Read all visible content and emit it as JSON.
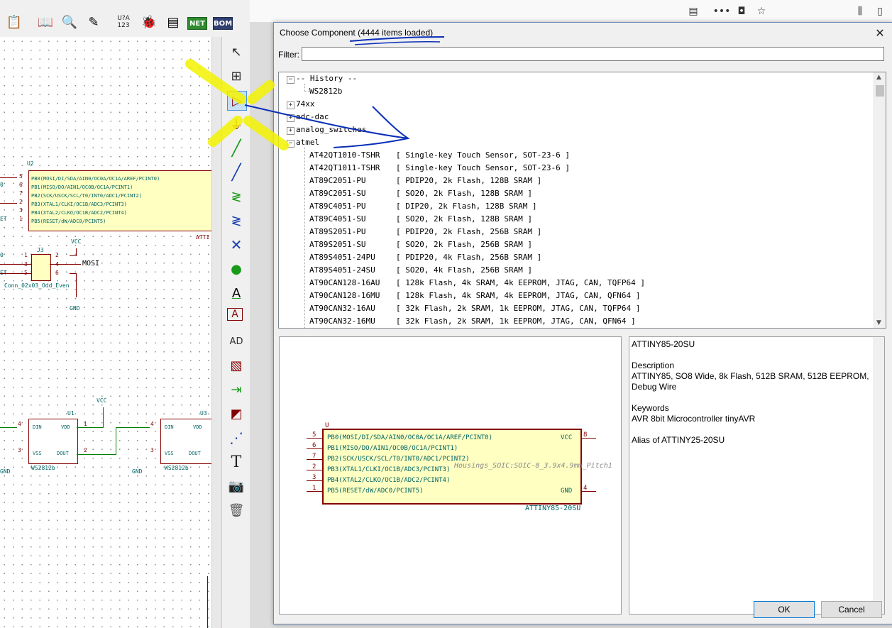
{
  "toolbar": {
    "icons": [
      "paste-icon",
      "library-editor-icon",
      "library-browser-icon",
      "annotate-icon",
      "symbol-unit-icon",
      "erc-icon",
      "footprint-assign-icon",
      "netlist-icon",
      "bom-icon"
    ],
    "symbol_unit_label": "U?A",
    "symbol_unit_sub": "123",
    "net_label": "NET",
    "bom_label": "BOM"
  },
  "schematic": {
    "u2": {
      "ref": "U2",
      "value": "ATTI",
      "pins": [
        "PB0(MOSI/DI/SDA/AIN0/OC0A/OC1A/AREF/PCINT0)",
        "PB1(MISO/DO/AIN1/OC0B/OC1A/PCINT1)",
        "PB2(SCK/USCK/SCL/T0/INT0/ADC1/PCINT2)",
        "PB3(XTAL1/CLKI/OC1B/ADC3/PCINT3)",
        "PB4(XTAL2/CLKO/OC1B/ADC2/PCINT4)",
        "PB5(RESET/dW/ADC0/PCINT5)"
      ],
      "pin_numbers": [
        "5",
        "6",
        "7",
        "2",
        "3",
        "1"
      ],
      "left_labels": [
        "",
        "0",
        "",
        "",
        "",
        "ET"
      ]
    },
    "j3": {
      "ref": "J3",
      "value": "Conn_02x03_Odd_Even",
      "left_nums": [
        "1",
        "3",
        "5"
      ],
      "right_nums": [
        "2",
        "4",
        "6"
      ],
      "left_labels": [
        "0",
        "",
        "ET"
      ],
      "mosi_label": "MOSI",
      "vcc_label": "VCC",
      "gnd_label": "GND"
    },
    "u1": {
      "ref": "U1",
      "value": "WS2812b",
      "pins": [
        "DIN",
        "VDD",
        "VSS",
        "DOUT"
      ],
      "pin_nums": [
        "4",
        "1",
        "3",
        "2"
      ],
      "vcc_label": "VCC",
      "gnd_label": "GND"
    },
    "u3": {
      "ref": "U3",
      "value": "WS2812b",
      "pins": [
        "DIN",
        "VDD",
        "VSS",
        "DOUT"
      ],
      "pin_nums": [
        "4",
        "3"
      ],
      "gnd_label": "GND"
    },
    "left_gnd": "GND"
  },
  "right_toolbar": {
    "icons": [
      "select-arrow-icon",
      "highlight-net-icon",
      "place-symbol-icon",
      "place-power-icon",
      "wire-icon",
      "bus-icon",
      "wire-bus-entry-icon",
      "bus-bus-entry-icon",
      "no-connect-icon",
      "junction-icon",
      "net-label-icon",
      "global-label-icon",
      "hierarchical-label-icon",
      "hierarchical-sheet-icon",
      "import-sheet-pin-icon",
      "sheet-pin-icon",
      "graphic-line-icon",
      "text-icon",
      "image-icon",
      "delete-icon"
    ],
    "net_label_letter": "A",
    "global_label_letter": "A",
    "hier_label_letters": "AD",
    "text_letter": "T"
  },
  "browser": {
    "icons": [
      "reader-view-icon",
      "more-menu-icon",
      "pocket-icon",
      "bookmark-star-icon",
      "library-icon",
      "sidebar-icon",
      "app-menu-icon"
    ]
  },
  "dialog": {
    "title": "Choose Component (4444 items loaded)",
    "filter_label": "Filter:",
    "filter_value": "",
    "tree": [
      {
        "kind": "group",
        "label": "-- History --",
        "expanded": true,
        "level": 0
      },
      {
        "kind": "item",
        "name": "WS2812b",
        "desc": "",
        "level": 1
      },
      {
        "kind": "group",
        "label": "74xx",
        "expanded": false,
        "level": 0
      },
      {
        "kind": "group",
        "label": "adc-dac",
        "expanded": false,
        "level": 0
      },
      {
        "kind": "group",
        "label": "analog_switches",
        "expanded": false,
        "level": 0
      },
      {
        "kind": "group",
        "label": "atmel",
        "expanded": true,
        "level": 0
      },
      {
        "kind": "item",
        "name": "AT42QT1010-TSHR",
        "desc": "[ Single-key Touch Sensor, SOT-23-6 ]",
        "level": 1
      },
      {
        "kind": "item",
        "name": "AT42QT1011-TSHR",
        "desc": "[ Single-key Touch Sensor, SOT-23-6 ]",
        "level": 1
      },
      {
        "kind": "item",
        "name": "AT89C2051-PU",
        "desc": "[ PDIP20, 2k Flash, 128B SRAM ]",
        "level": 1
      },
      {
        "kind": "item",
        "name": "AT89C2051-SU",
        "desc": "[ SO20, 2k Flash, 128B SRAM ]",
        "level": 1
      },
      {
        "kind": "item",
        "name": "AT89C4051-PU",
        "desc": "[ DIP20, 2k Flash, 128B SRAM ]",
        "level": 1
      },
      {
        "kind": "item",
        "name": "AT89C4051-SU",
        "desc": "[ SO20, 2k Flash, 128B SRAM ]",
        "level": 1
      },
      {
        "kind": "item",
        "name": "AT89S2051-PU",
        "desc": "[ PDIP20, 2k Flash, 256B SRAM ]",
        "level": 1
      },
      {
        "kind": "item",
        "name": "AT89S2051-SU",
        "desc": "[ SO20, 2k Flash, 256B SRAM ]",
        "level": 1
      },
      {
        "kind": "item",
        "name": "AT89S4051-24PU",
        "desc": "[ PDIP20, 4k Flash, 256B SRAM ]",
        "level": 1
      },
      {
        "kind": "item",
        "name": "AT89S4051-24SU",
        "desc": "[ SO20, 4k Flash, 256B SRAM ]",
        "level": 1
      },
      {
        "kind": "item",
        "name": "AT90CAN128-16AU",
        "desc": "[ 128k Flash, 4k SRAM, 4k EEPROM, JTAG, CAN, TQFP64 ]",
        "level": 1
      },
      {
        "kind": "item",
        "name": "AT90CAN128-16MU",
        "desc": "[ 128k Flash, 4k SRAM, 4k EEPROM, JTAG, CAN, QFN64 ]",
        "level": 1
      },
      {
        "kind": "item",
        "name": "AT90CAN32-16AU",
        "desc": "[ 32k Flash, 2k SRAM, 1k EEPROM, JTAG, CAN, TQFP64 ]",
        "level": 1
      },
      {
        "kind": "item",
        "name": "AT90CAN32-16MU",
        "desc": "[ 32k Flash, 2k SRAM, 1k EEPROM, JTAG, CAN, QFN64 ]",
        "level": 1
      }
    ],
    "preview": {
      "ref": "U",
      "value": "ATTINY85-20SU",
      "footprint": "Housings_SOIC:SOIC-8_3.9x4.9mm_Pitch1",
      "left_pins": [
        {
          "num": "5",
          "name": "PB0(MOSI/DI/SDA/AIN0/OC0A/OC1A/AREF/PCINT0)"
        },
        {
          "num": "6",
          "name": "PB1(MISO/DO/AIN1/OC0B/OC1A/PCINT1)"
        },
        {
          "num": "7",
          "name": "PB2(SCK/USCK/SCL/T0/INT0/ADC1/PCINT2)"
        },
        {
          "num": "2",
          "name": "PB3(XTAL1/CLKI/OC1B/ADC3/PCINT3)"
        },
        {
          "num": "3",
          "name": "PB4(XTAL2/CLKO/OC1B/ADC2/PCINT4)"
        },
        {
          "num": "1",
          "name": "PB5(RESET/dW/ADC0/PCINT5)"
        }
      ],
      "right_pins": [
        {
          "num": "8",
          "name": "VCC"
        },
        {
          "num": "4",
          "name": "GND"
        }
      ]
    },
    "details": {
      "name": "ATTINY85-20SU",
      "description_heading": "Description",
      "description": "ATTINY85, SO8 Wide, 8k Flash, 512B SRAM, 512B EEPROM, Debug Wire",
      "keywords_heading": "Keywords",
      "keywords": "AVR 8bit Microcontroller tinyAVR",
      "alias": "Alias of ATTINY25-20SU"
    },
    "ok_label": "OK",
    "cancel_label": "Cancel"
  },
  "colors": {
    "pin_red": "#840000",
    "pin_text_teal": "#006464",
    "wire_green": "#008000",
    "component_fill": "#ffffc2",
    "annotation_blue": "#0a2fb8",
    "highlight_yellow": "#f2f200"
  }
}
